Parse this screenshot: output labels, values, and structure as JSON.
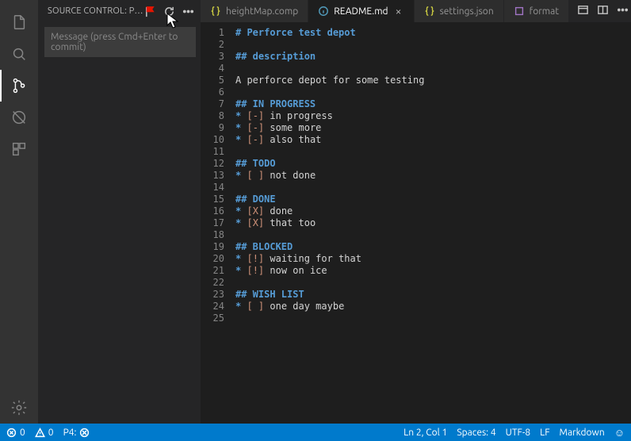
{
  "sidebar": {
    "title": "SOURCE CONTROL: PE…",
    "commit_placeholder": "Message (press Cmd+Enter to commit)"
  },
  "tabs": [
    {
      "label": "heightMap.comp",
      "icon": "braces",
      "color": "yellow",
      "active": false,
      "close": false
    },
    {
      "label": "README.md",
      "icon": "info",
      "color": "blue",
      "active": true,
      "close": true
    },
    {
      "label": "settings.json",
      "icon": "braces",
      "color": "yellow",
      "active": false,
      "close": false
    },
    {
      "label": "format",
      "icon": "box",
      "color": "purple",
      "active": false,
      "close": false
    }
  ],
  "editor": {
    "lines": [
      {
        "n": 1,
        "kind": "h1",
        "text": "Perforce test depot"
      },
      {
        "n": 2,
        "kind": "blank",
        "text": ""
      },
      {
        "n": 3,
        "kind": "h2",
        "text": "description"
      },
      {
        "n": 4,
        "kind": "blank",
        "text": ""
      },
      {
        "n": 5,
        "kind": "text",
        "text": "A perforce depot for some testing"
      },
      {
        "n": 6,
        "kind": "blank",
        "text": ""
      },
      {
        "n": 7,
        "kind": "h2",
        "text": "IN PROGRESS"
      },
      {
        "n": 8,
        "kind": "item",
        "box": "[-]",
        "text": "in progress"
      },
      {
        "n": 9,
        "kind": "item",
        "box": "[-]",
        "text": "some more"
      },
      {
        "n": 10,
        "kind": "item",
        "box": "[-]",
        "text": "also that"
      },
      {
        "n": 11,
        "kind": "blank",
        "text": ""
      },
      {
        "n": 12,
        "kind": "h2",
        "text": "TODO"
      },
      {
        "n": 13,
        "kind": "item",
        "box": "[ ]",
        "text": "not done"
      },
      {
        "n": 14,
        "kind": "blank",
        "text": ""
      },
      {
        "n": 15,
        "kind": "h2",
        "text": "DONE"
      },
      {
        "n": 16,
        "kind": "item",
        "box": "[X]",
        "text": "done"
      },
      {
        "n": 17,
        "kind": "item",
        "box": "[X]",
        "text": "that too"
      },
      {
        "n": 18,
        "kind": "blank",
        "text": ""
      },
      {
        "n": 19,
        "kind": "h2",
        "text": "BLOCKED"
      },
      {
        "n": 20,
        "kind": "item",
        "box": "[!]",
        "text": "waiting for that"
      },
      {
        "n": 21,
        "kind": "item",
        "box": "[!]",
        "text": "now on ice"
      },
      {
        "n": 22,
        "kind": "blank",
        "text": ""
      },
      {
        "n": 23,
        "kind": "h2",
        "text": "WISH LIST"
      },
      {
        "n": 24,
        "kind": "item",
        "box": "[ ]",
        "text": "one day maybe"
      },
      {
        "n": 25,
        "kind": "blank",
        "text": ""
      }
    ]
  },
  "status": {
    "errors": "0",
    "warnings": "0",
    "p4": "P4:",
    "ln_col": "Ln 2, Col 1",
    "spaces": "Spaces: 4",
    "encoding": "UTF-8",
    "eol": "LF",
    "lang": "Markdown"
  }
}
